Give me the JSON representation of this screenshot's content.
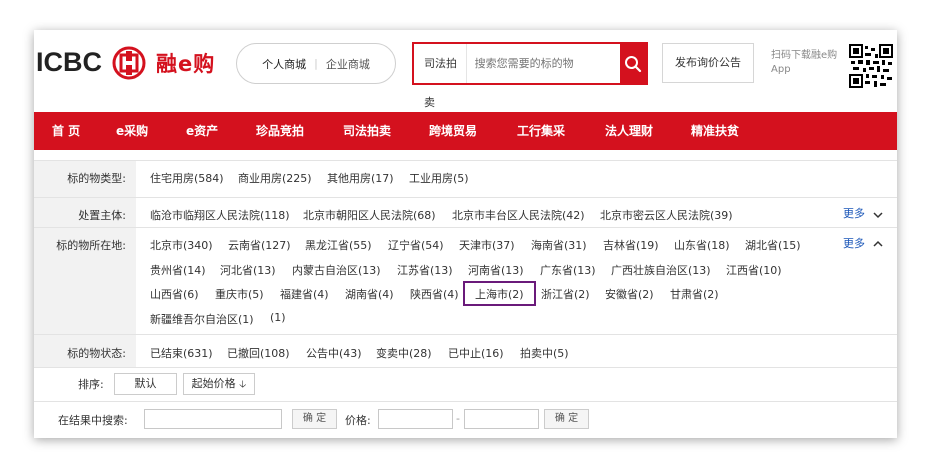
{
  "header": {
    "logo_text": "ICBC",
    "brand": "融e购",
    "mall_switch": {
      "personal": "个人商城",
      "sep": "|",
      "enterprise": "企业商城"
    },
    "search": {
      "category": "司法拍卖",
      "placeholder": "搜索您需要的标的物"
    },
    "notice_button": "发布询价公告",
    "qr_text": "扫码下载融e购App"
  },
  "nav": [
    "首 页",
    "e采购",
    "e资产",
    "珍品竞拍",
    "司法拍卖",
    "跨境贸易",
    "工行集采",
    "法人理财",
    "精准扶贫"
  ],
  "filters": {
    "type": {
      "label": "标的物类型:",
      "options": [
        "住宅用房(584)",
        "商业用房(225)",
        "其他用房(17)",
        "工业用房(5)"
      ]
    },
    "court": {
      "label": "处置主体:",
      "options": [
        "临沧市临翔区人民法院(118)",
        "北京市朝阳区人民法院(68)",
        "北京市丰台区人民法院(42)",
        "北京市密云区人民法院(39)"
      ],
      "more": "更多"
    },
    "location": {
      "label": "标的物所在地:",
      "more": "更多",
      "line1": [
        "北京市(340)",
        "云南省(127)",
        "黑龙江省(55)",
        "辽宁省(54)",
        "天津市(37)",
        "海南省(31)",
        "吉林省(19)",
        "山东省(18)",
        "湖北省(15)"
      ],
      "line2": [
        "贵州省(14)",
        "河北省(13)",
        "内蒙古自治区(13)",
        "江苏省(13)",
        "河南省(13)",
        "广东省(13)",
        "广西壮族自治区(13)",
        "江西省(10)"
      ],
      "line3": [
        "山西省(6)",
        "重庆市(5)",
        "福建省(4)",
        "湖南省(4)",
        "陕西省(4)",
        "上海市(2)",
        "浙江省(2)",
        "安徽省(2)",
        "甘肃省(2)"
      ],
      "line4": [
        "新疆维吾尔自治区(1)",
        "(1)"
      ]
    },
    "status": {
      "label": "标的物状态:",
      "options": [
        "已结束(631)",
        "已撤回(108)",
        "公告中(43)",
        "变卖中(28)",
        "已中止(16)",
        "拍卖中(5)"
      ]
    }
  },
  "sort": {
    "label": "排序:",
    "default": "默认",
    "start_price": "起始价格",
    "arrow": "🡣"
  },
  "result_search": {
    "label": "在结果中搜索:",
    "confirm": "确 定",
    "price_label": "价格:",
    "dash": "-",
    "confirm2": "确 定"
  }
}
